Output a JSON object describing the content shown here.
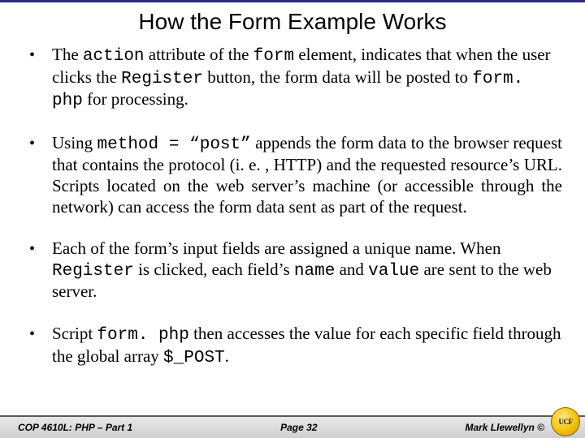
{
  "title": "How the Form Example Works",
  "bullets": [
    {
      "segments": [
        {
          "t": "The "
        },
        {
          "t": "action",
          "mono": true
        },
        {
          "t": " attribute of the "
        },
        {
          "t": "form",
          "mono": true
        },
        {
          "t": " element, indicates that when the user clicks the "
        },
        {
          "t": "Register",
          "mono": true
        },
        {
          "t": " button, the form data will be posted to "
        },
        {
          "t": "form. php",
          "mono": true
        },
        {
          "t": " for processing."
        }
      ],
      "justify": false
    },
    {
      "segments": [
        {
          "t": "Using "
        },
        {
          "t": "method = “post”",
          "mono": true
        },
        {
          "t": " appends the form data to the browser request that contains the protocol (i. e. , HTTP) and the requested resource’s URL.  Scripts located on the web server’s machine (or accessible through the network) can access the form data sent as part of the request."
        }
      ],
      "justify": true
    },
    {
      "segments": [
        {
          "t": "Each of the form’s input fields are assigned a unique name.  When "
        },
        {
          "t": "Register",
          "mono": true
        },
        {
          "t": " is clicked, each field’s "
        },
        {
          "t": "name",
          "mono": true
        },
        {
          "t": " and "
        },
        {
          "t": "value",
          "mono": true
        },
        {
          "t": " are sent to the web server."
        }
      ],
      "justify": false
    },
    {
      "segments": [
        {
          "t": "Script "
        },
        {
          "t": "form. php",
          "mono": true
        },
        {
          "t": " then accesses the value for each specific field through the global array "
        },
        {
          "t": "$_POST",
          "mono": true
        },
        {
          "t": "."
        }
      ],
      "justify": false
    }
  ],
  "footer": {
    "course": "COP 4610L: PHP – Part 1",
    "page": "Page 32",
    "author": "Mark Llewellyn ©"
  },
  "logo": {
    "name": "ucf-logo",
    "text": "UCF"
  }
}
